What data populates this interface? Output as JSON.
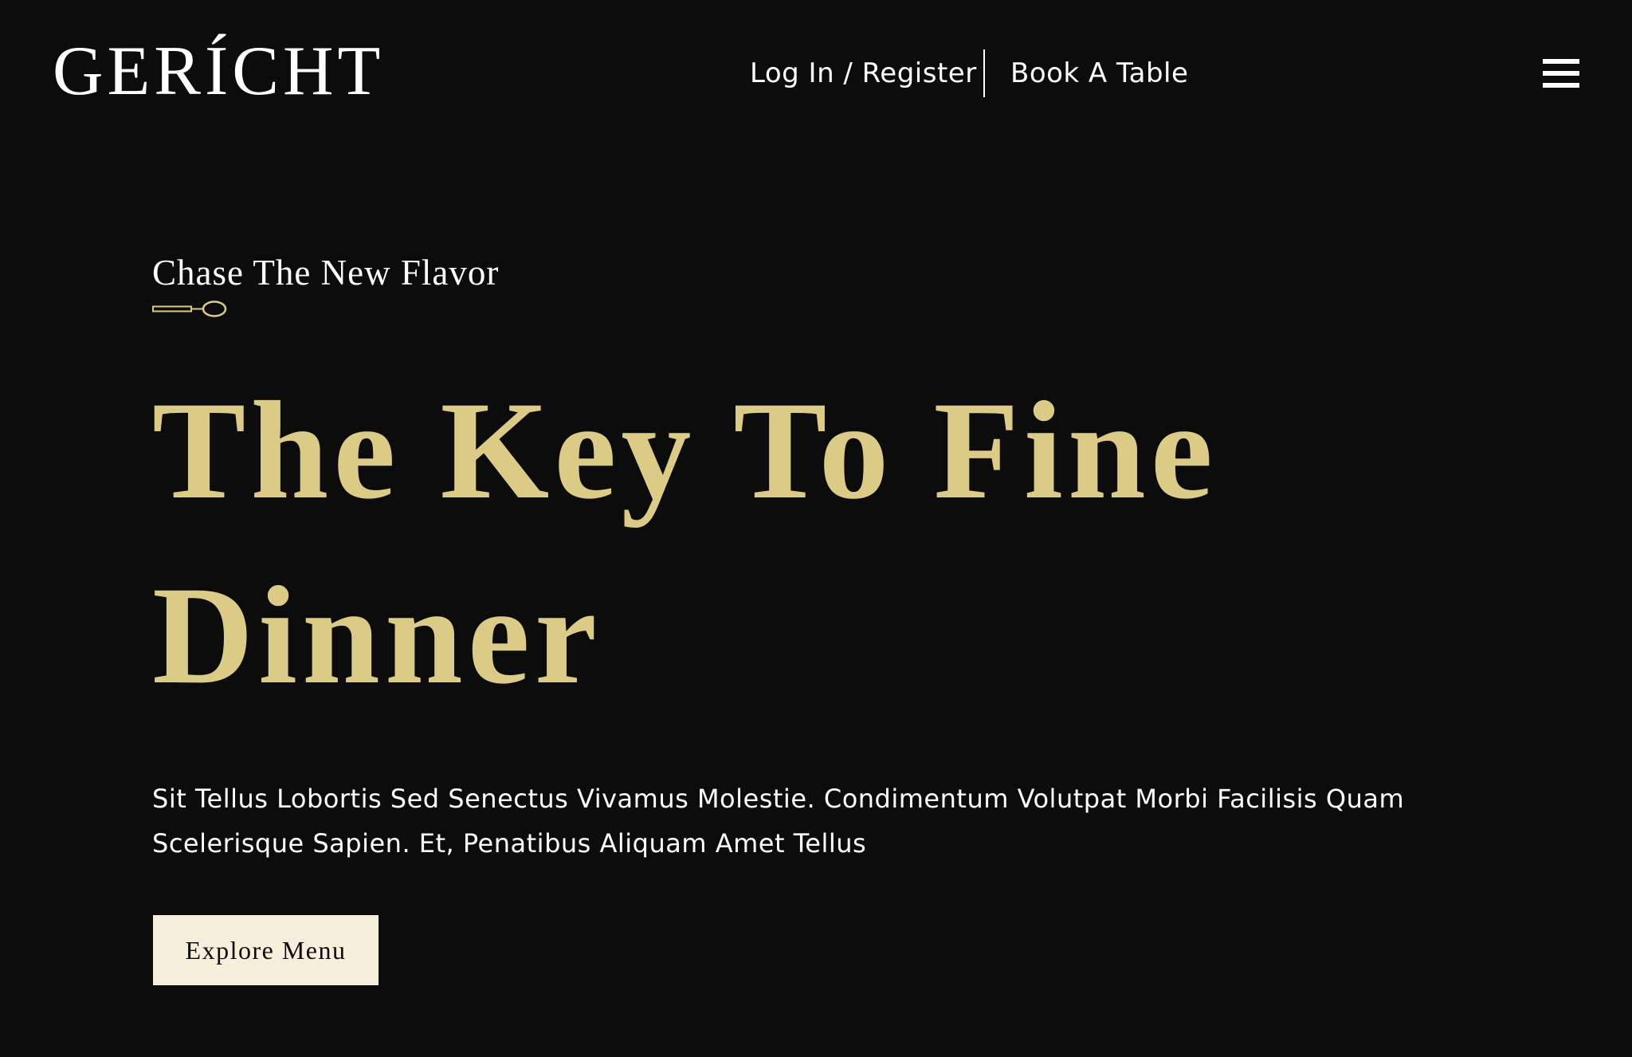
{
  "navbar": {
    "logo": "GERÍCHT",
    "login_label": "Log In / Register",
    "book_label": "Book A Table",
    "menu_icon": "hamburger-menu-icon"
  },
  "hero": {
    "subtitle": "Chase The New Flavor",
    "spoon_icon": "spoon-icon",
    "headline": "The Key To Fine Dinner",
    "description": "Sit Tellus Lobortis Sed Senectus Vivamus Molestie. Condimentum Volutpat Morbi Facilisis Quam Scelerisque Sapien. Et, Penatibus Aliquam Amet Tellus",
    "button_label": "Explore Menu"
  },
  "colors": {
    "background": "#0c0c0c",
    "accent_gold": "#dcca87",
    "button_bg": "#f5efdb",
    "text": "#ffffff"
  }
}
